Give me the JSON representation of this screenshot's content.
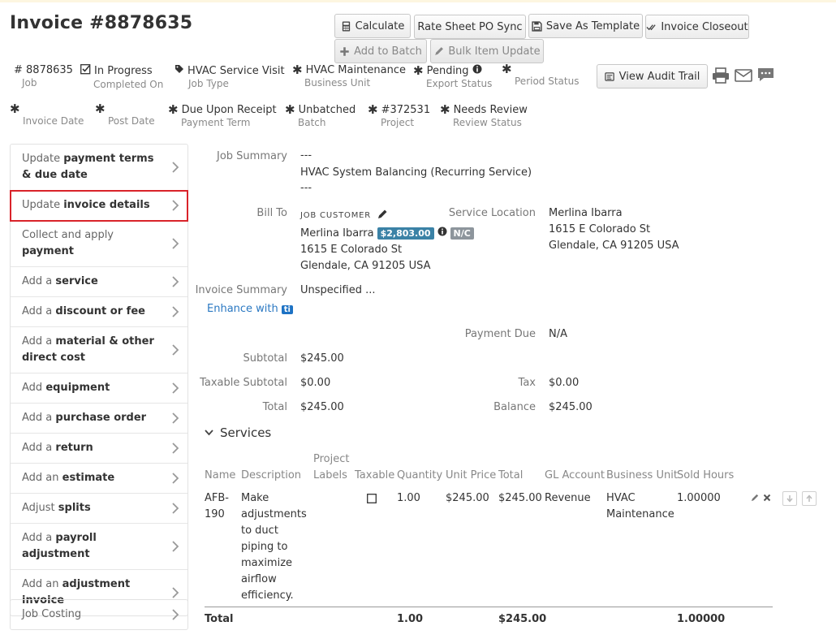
{
  "title": "Invoice #8878635",
  "toolbar": {
    "calculate": "Calculate",
    "rate_sheet": "Rate Sheet PO Sync",
    "save_template": "Save As Template",
    "closeout": "Invoice Closeout",
    "add_batch": "Add to Batch",
    "bulk_update": "Bulk Item Update",
    "audit_trail": "View Audit Trail"
  },
  "fields_row1": {
    "job": {
      "value": "# 8878635",
      "label": "Job"
    },
    "completed": {
      "value": "In Progress",
      "label": "Completed On"
    },
    "job_type": {
      "value": "HVAC Service Visit",
      "label": "Job Type"
    },
    "business_unit": {
      "value": "HVAC Maintenance",
      "label": "Business Unit"
    },
    "export_status": {
      "value": "Pending",
      "label": "Export Status"
    },
    "period_status": {
      "value": "",
      "label": "Period Status"
    }
  },
  "fields_row2": {
    "invoice_date": {
      "value": "",
      "label": "Invoice Date"
    },
    "post_date": {
      "value": "",
      "label": "Post Date"
    },
    "payment_term": {
      "value": "Due Upon Receipt",
      "label": "Payment Term"
    },
    "batch": {
      "value": "Unbatched",
      "label": "Batch"
    },
    "project": {
      "value": "#372531",
      "label": "Project"
    },
    "review_status": {
      "value": "Needs Review",
      "label": "Review Status"
    }
  },
  "menu": [
    {
      "pre": "Update ",
      "bold": "payment terms & due date",
      "post": ""
    },
    {
      "pre": "Update ",
      "bold": "invoice details",
      "post": ""
    },
    {
      "pre": "Collect and apply ",
      "bold": "payment",
      "post": ""
    },
    {
      "pre": "Add a ",
      "bold": "service",
      "post": ""
    },
    {
      "pre": "Add a ",
      "bold": "discount or fee",
      "post": ""
    },
    {
      "pre": "Add a ",
      "bold": "material & other direct cost",
      "post": ""
    },
    {
      "pre": "Add ",
      "bold": "equipment",
      "post": ""
    },
    {
      "pre": "Add a ",
      "bold": "purchase order",
      "post": ""
    },
    {
      "pre": "Add a ",
      "bold": "return",
      "post": ""
    },
    {
      "pre": "Add an ",
      "bold": "estimate",
      "post": ""
    },
    {
      "pre": "Adjust ",
      "bold": "splits",
      "post": ""
    },
    {
      "pre": "Add a ",
      "bold": "payroll adjustment",
      "post": ""
    },
    {
      "pre": "Add an ",
      "bold": "adjustment invoice",
      "post": ""
    }
  ],
  "job_costing": "Job Costing",
  "summary": {
    "job_summary_label": "Job Summary",
    "job_summary_line1": "---",
    "job_summary_line2": "HVAC System Balancing (Recurring Service)",
    "job_summary_line3": "---",
    "bill_to_label": "Bill To",
    "job_customer": "JOB CUSTOMER",
    "customer_name": "Merlina Ibarra",
    "customer_balance": "$2,803.00",
    "nc_badge": "N/C",
    "bill_addr1": "1615 E Colorado St",
    "bill_addr2": "Glendale, CA 91205 USA",
    "service_location_label": "Service Location",
    "loc_name": "Merlina Ibarra",
    "loc_addr1": "1615 E Colorado St",
    "loc_addr2": "Glendale, CA 91205 USA",
    "invoice_summary_label": "Invoice Summary",
    "invoice_summary_value": "Unspecified ...",
    "enhance_with": "Enhance with",
    "ti": "ti",
    "payment_due_label": "Payment Due",
    "payment_due_value": "N/A",
    "subtotal_label": "Subtotal",
    "subtotal_value": "$245.00",
    "taxable_label": "Taxable Subtotal",
    "taxable_value": "$0.00",
    "tax_label": "Tax",
    "tax_value": "$0.00",
    "total_label": "Total",
    "total_value": "$245.00",
    "balance_label": "Balance",
    "balance_value": "$245.00"
  },
  "services": {
    "heading": "Services",
    "headers": {
      "name": "Name",
      "description": "Description",
      "project_labels": "Project Labels",
      "taxable": "Taxable",
      "quantity": "Quantity",
      "unit_price": "Unit Price",
      "total": "Total",
      "gl_account": "GL Account",
      "business_unit": "Business Unit",
      "sold_hours": "Sold Hours"
    },
    "row": {
      "name": "AFB-190",
      "description": "Make adjustments to duct piping to maximize airflow efficiency.",
      "quantity": "1.00",
      "unit_price": "$245.00",
      "total": "$245.00",
      "gl_account": "Revenue",
      "business_unit": "HVAC Maintenance",
      "sold_hours": "1.00000"
    },
    "totals": {
      "label": "Total",
      "quantity": "1.00",
      "total": "$245.00",
      "sold_hours": "1.00000"
    }
  }
}
